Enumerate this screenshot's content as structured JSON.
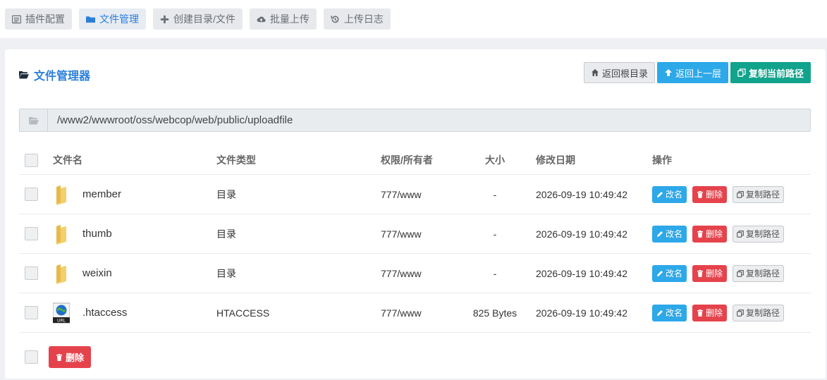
{
  "tabs": [
    {
      "label": "插件配置",
      "icon": "list-icon",
      "active": false
    },
    {
      "label": "文件管理",
      "icon": "folder-icon",
      "active": true
    },
    {
      "label": "创建目录/文件",
      "icon": "plus-icon",
      "active": false
    },
    {
      "label": "批量上传",
      "icon": "cloud-upload-icon",
      "active": false
    },
    {
      "label": "上传日志",
      "icon": "history-icon",
      "active": false
    }
  ],
  "panel": {
    "title": "文件管理器",
    "actions": {
      "root": "返回根目录",
      "up": "返回上一层",
      "copy_path": "复制当前路径"
    },
    "path": "/www2/wwwroot/oss/webcop/web/public/uploadfile"
  },
  "table": {
    "headers": {
      "name": "文件名",
      "type": "文件类型",
      "perm": "权限/所有者",
      "size": "大小",
      "date": "修改日期",
      "ops": "操作"
    },
    "rows": [
      {
        "name": "member",
        "type": "目录",
        "perm": "777/www",
        "size": "-",
        "date": "2026-09-19 10:49:42",
        "icon": "folder-icon"
      },
      {
        "name": "thumb",
        "type": "目录",
        "perm": "777/www",
        "size": "-",
        "date": "2026-09-19 10:49:42",
        "icon": "folder-icon"
      },
      {
        "name": "weixin",
        "type": "目录",
        "perm": "777/www",
        "size": "-",
        "date": "2026-09-19 10:49:42",
        "icon": "folder-icon"
      },
      {
        "name": ".htaccess",
        "type": "HTACCESS",
        "perm": "777/www",
        "size": "825 Bytes",
        "date": "2026-09-19 10:49:42",
        "icon": "url-file-icon"
      }
    ],
    "ops": {
      "rename": "改名",
      "delete": "删除",
      "copy_path": "复制路径"
    }
  },
  "bulk": {
    "delete": "删除"
  },
  "colors": {
    "accent": "#2b7fd9",
    "info": "#2da8e8",
    "danger": "#e5434c",
    "teal": "#12a38c"
  }
}
